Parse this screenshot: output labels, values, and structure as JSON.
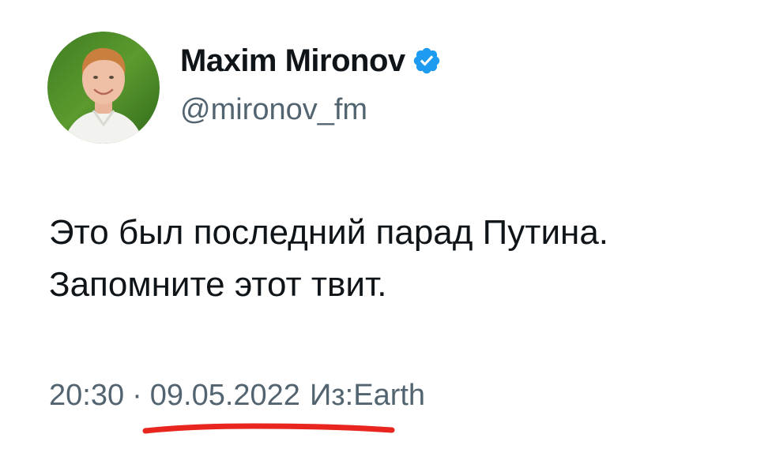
{
  "author": {
    "display_name": "Maxim Mironov",
    "handle": "@mironov_fm",
    "verified": true,
    "verified_color": "#1d9bf0"
  },
  "tweet": {
    "lines": [
      "Это был последний парад Путина.",
      "Запомните этот твит."
    ]
  },
  "meta": {
    "time": "20:30",
    "separator": "·",
    "date": "09.05.2022",
    "source": "Из:Earth"
  },
  "annotation": {
    "underline_color": "#e8261f"
  },
  "icons": {
    "avatar": "avatar-photo",
    "verified": "verified-badge-icon"
  }
}
